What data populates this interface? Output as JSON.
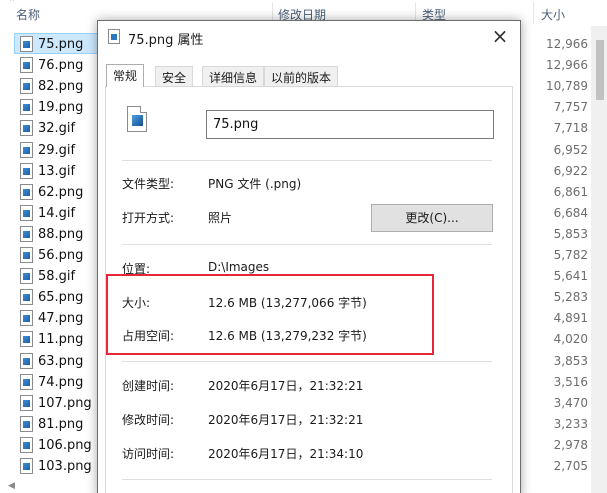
{
  "explorer": {
    "columns": {
      "name": "名称",
      "date": "修改日期",
      "type": "类型",
      "size": "大小"
    },
    "files": [
      {
        "name": "75.png",
        "size": "12,966",
        "selected": true
      },
      {
        "name": "76.png",
        "size": "12,966"
      },
      {
        "name": "82.png",
        "size": "10,789"
      },
      {
        "name": "19.png",
        "size": "7,757"
      },
      {
        "name": "32.gif",
        "size": "7,718"
      },
      {
        "name": "29.gif",
        "size": "6,952"
      },
      {
        "name": "13.gif",
        "size": "6,922"
      },
      {
        "name": "62.png",
        "size": "6,861"
      },
      {
        "name": "14.gif",
        "size": "6,684"
      },
      {
        "name": "88.png",
        "size": "5,853"
      },
      {
        "name": "56.png",
        "size": "5,782"
      },
      {
        "name": "58.gif",
        "size": "5,641"
      },
      {
        "name": "65.png",
        "size": "5,283"
      },
      {
        "name": "47.png",
        "size": "4,891"
      },
      {
        "name": "11.png",
        "size": "4,020"
      },
      {
        "name": "63.png",
        "size": "3,853"
      },
      {
        "name": "74.png",
        "size": "3,516"
      },
      {
        "name": "107.png",
        "size": "3,470"
      },
      {
        "name": "81.png",
        "size": "3,233"
      },
      {
        "name": "106.png",
        "size": "2,978"
      },
      {
        "name": "103.png",
        "size": "2,705"
      }
    ]
  },
  "dialog": {
    "title": "75.png 属性",
    "close": "×",
    "tabs": [
      "常规",
      "安全",
      "详细信息",
      "以前的版本"
    ],
    "file_name": "75.png",
    "file_type_label": "文件类型:",
    "file_type_value": "PNG 文件 (.png)",
    "open_with_label": "打开方式:",
    "open_with_value": "照片",
    "change_button": "更改(C)...",
    "location_label": "位置:",
    "location_value": "D:\\Images",
    "size_label": "大小:",
    "size_value": "12.6 MB (13,277,066 字节)",
    "disk_size_label": "占用空间:",
    "disk_size_value": "12.6 MB (13,279,232 字节)",
    "created_label": "创建时间:",
    "created_value": "2020年6月17日，21:32:21",
    "modified_label": "修改时间:",
    "modified_value": "2020年6月17日，21:32:21",
    "accessed_label": "访问时间:",
    "accessed_value": "2020年6月17日，21:34:10"
  },
  "colors": {
    "highlight": "#e8263a",
    "selection": "#cce8ff"
  }
}
